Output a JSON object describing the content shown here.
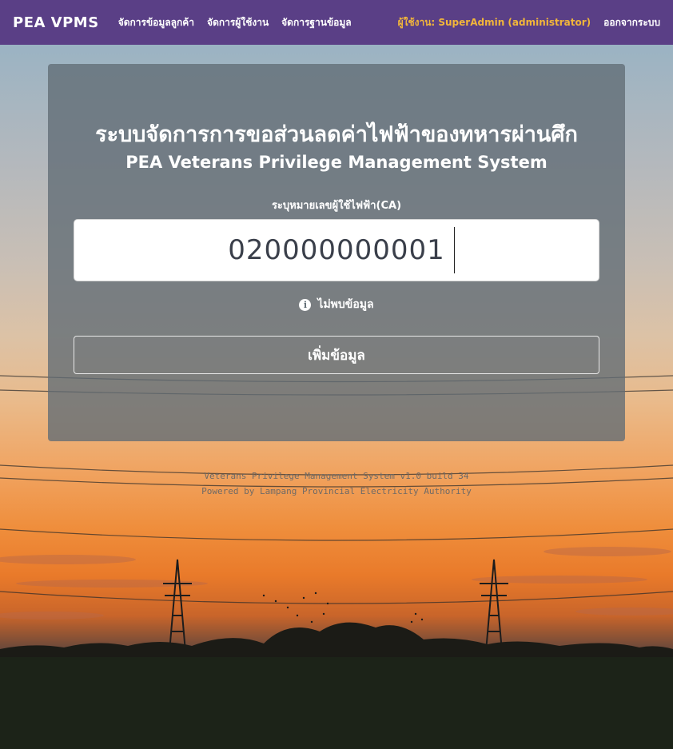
{
  "navbar": {
    "brand": "PEA VPMS",
    "links": [
      "จัดการข้อมูลลูกค้า",
      "จัดการผู้ใช้งาน",
      "จัดการฐานข้อมูล"
    ],
    "user_label": "ผู้ใช้งาน: SuperAdmin (administrator)",
    "logout_label": "ออกจากระบบ"
  },
  "main": {
    "title_th": "ระบบจัดการการขอส่วนลดค่าไฟฟ้าของทหารผ่านศึก",
    "title_en": "PEA Veterans Privilege Management System",
    "ca_label": "ระบุหมายเลขผู้ใช้ไฟฟ้า(CA)",
    "ca_value": "020000000001",
    "hint_text": "ไม่พบข้อมูล",
    "hint_icon": "info-icon",
    "add_button_label": "เพิ่มข้อมูล"
  },
  "footer": {
    "line1": "Veterans Privilege Management System v1.0 build 34",
    "line2": "Powered by Lampang Provincial Electricity Authority"
  },
  "colors": {
    "navbar": "#5a3f86",
    "user_label": "#f2b63a",
    "card": "#606c74"
  }
}
